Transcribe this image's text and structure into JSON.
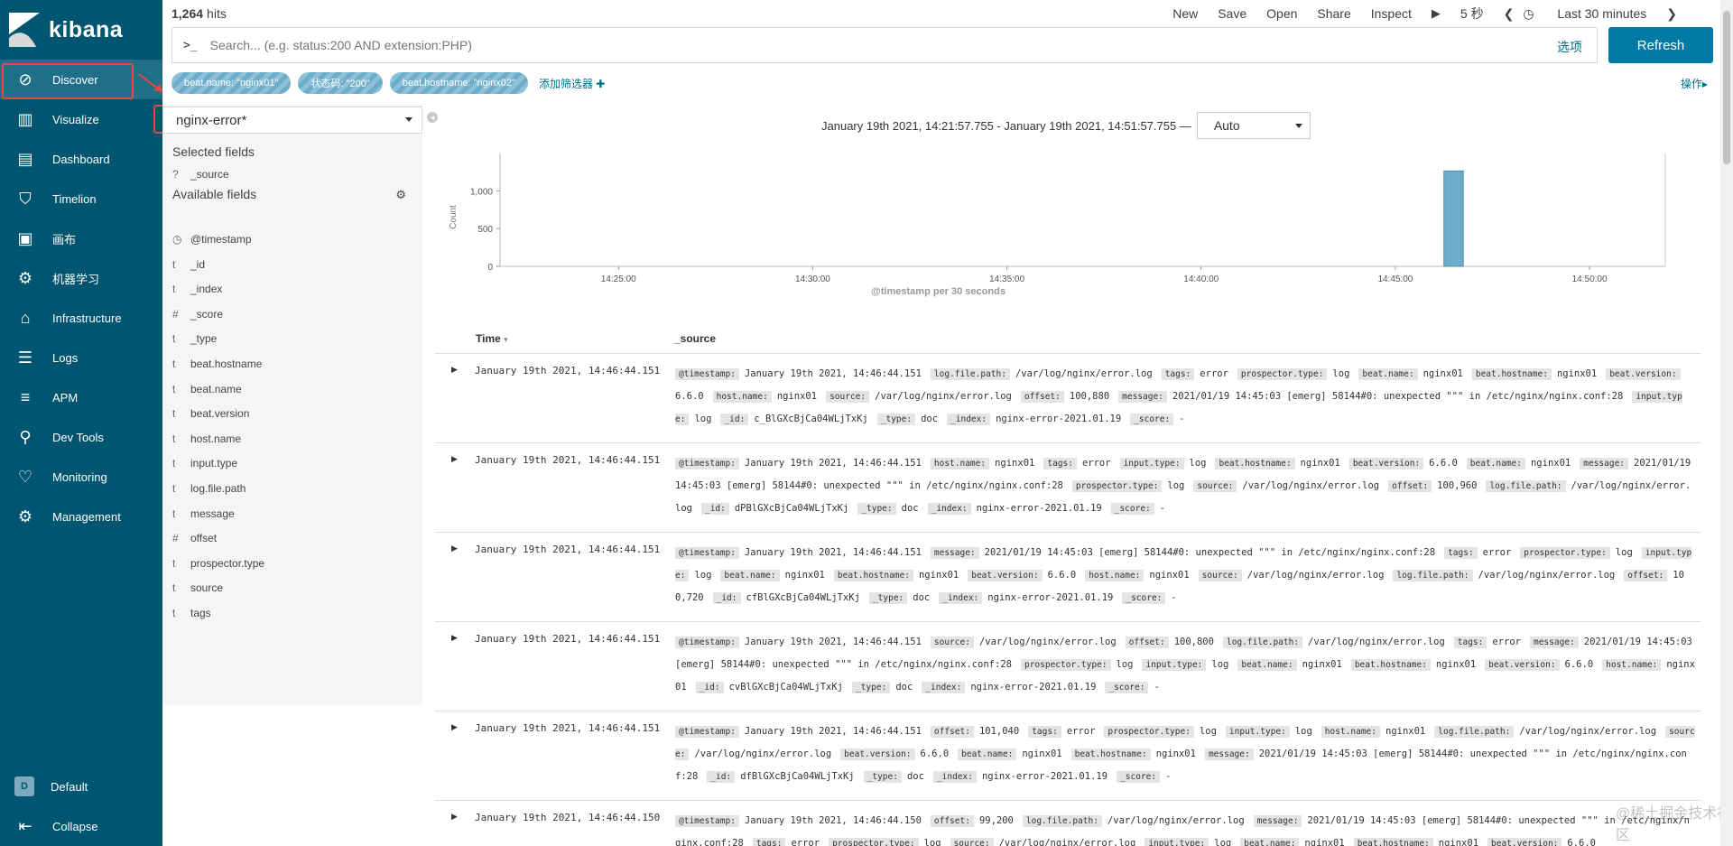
{
  "app": {
    "brand": "kibana"
  },
  "nav": {
    "items": [
      {
        "label": "Discover",
        "icon": "compass-icon"
      },
      {
        "label": "Visualize",
        "icon": "bar-chart-icon"
      },
      {
        "label": "Dashboard",
        "icon": "dashboard-icon"
      },
      {
        "label": "Timelion",
        "icon": "shield-icon"
      },
      {
        "label": "画布",
        "icon": "canvas-icon"
      },
      {
        "label": "机器学习",
        "icon": "machine-learning-icon"
      },
      {
        "label": "Infrastructure",
        "icon": "infrastructure-icon"
      },
      {
        "label": "Logs",
        "icon": "logs-icon"
      },
      {
        "label": "APM",
        "icon": "apm-icon"
      },
      {
        "label": "Dev Tools",
        "icon": "wrench-icon"
      },
      {
        "label": "Monitoring",
        "icon": "heartbeat-icon"
      },
      {
        "label": "Management",
        "icon": "gear-icon"
      }
    ],
    "space_badge": "D",
    "space_label": "Default",
    "collapse_label": "Collapse"
  },
  "topbar": {
    "hits_count": "1,264",
    "hits_label": "hits",
    "new": "New",
    "save": "Save",
    "open": "Open",
    "share": "Share",
    "inspect": "Inspect",
    "play_icon": "▶",
    "interval": "5 秒",
    "prev_icon": "❮",
    "time_range": "Last 30 minutes",
    "next_icon": "❯"
  },
  "search": {
    "prompt": ">_",
    "placeholder": "Search... (e.g. status:200 AND extension:PHP)",
    "options": "选项",
    "refresh": "Refresh"
  },
  "filters": {
    "pills": [
      "beat.name: \"nginx01\"",
      "状态码: \"200\"",
      "beat.hostname: \"nginx02\""
    ],
    "add_filter": "添加筛选器 ✚",
    "actions": "操作▸"
  },
  "fields_panel": {
    "index_pattern": "nginx-error*",
    "selected_heading": "Selected fields",
    "selected": [
      {
        "type": "?",
        "name": "_source"
      }
    ],
    "available_heading": "Available fields",
    "available": [
      {
        "type": "◷",
        "name": "@timestamp"
      },
      {
        "type": "t",
        "name": "_id"
      },
      {
        "type": "t",
        "name": "_index"
      },
      {
        "type": "#",
        "name": "_score"
      },
      {
        "type": "t",
        "name": "_type"
      },
      {
        "type": "t",
        "name": "beat.hostname"
      },
      {
        "type": "t",
        "name": "beat.name"
      },
      {
        "type": "t",
        "name": "beat.version"
      },
      {
        "type": "t",
        "name": "host.name"
      },
      {
        "type": "t",
        "name": "input.type"
      },
      {
        "type": "t",
        "name": "log.file.path"
      },
      {
        "type": "t",
        "name": "message"
      },
      {
        "type": "#",
        "name": "offset"
      },
      {
        "type": "t",
        "name": "prospector.type"
      },
      {
        "type": "t",
        "name": "source"
      },
      {
        "type": "t",
        "name": "tags"
      }
    ]
  },
  "histogram": {
    "range_text": "January 19th 2021, 14:21:57.755 - January 19th 2021, 14:51:57.755 —",
    "interval": "Auto"
  },
  "chart_data": {
    "type": "bar",
    "xlabel": "@timestamp per 30 seconds",
    "ylabel": "Count",
    "x_ticks": [
      "14:25:00",
      "14:30:00",
      "14:35:00",
      "14:40:00",
      "14:45:00",
      "14:50:00"
    ],
    "y_ticks": [
      "0",
      "500",
      "1,000"
    ],
    "ylim": [
      0,
      1400
    ],
    "x_range": [
      "14:21:57",
      "14:51:57"
    ],
    "bars": [
      {
        "x": "14:46:30",
        "value": 1264
      }
    ],
    "bar_color": "#6eadc9"
  },
  "table": {
    "time_header": "Time",
    "source_header": "_source",
    "rows": [
      {
        "time": "January 19th 2021, 14:46:44.151",
        "fields": [
          [
            "@timestamp:",
            "January 19th 2021, 14:46:44.151"
          ],
          [
            "log.file.path:",
            "/var/log/nginx/error.log"
          ],
          [
            "tags:",
            "error"
          ],
          [
            "prospector.type:",
            "log"
          ],
          [
            "beat.name:",
            "nginx01"
          ],
          [
            "beat.hostname:",
            "nginx01"
          ],
          [
            "beat.version:",
            "6.6.0"
          ],
          [
            "host.name:",
            "nginx01"
          ],
          [
            "source:",
            "/var/log/nginx/error.log"
          ],
          [
            "offset:",
            "100,880"
          ],
          [
            "message:",
            "2021/01/19 14:45:03 [emerg] 58144#0: unexpected \"\"\" in /etc/nginx/nginx.conf:28"
          ],
          [
            "input.type:",
            "log"
          ],
          [
            "_id:",
            "c_BlGXcBjCa04WLjTxKj"
          ],
          [
            "_type:",
            "doc"
          ],
          [
            "_index:",
            "nginx-error-2021.01.19"
          ],
          [
            "_score:",
            "-"
          ]
        ]
      },
      {
        "time": "January 19th 2021, 14:46:44.151",
        "fields": [
          [
            "@timestamp:",
            "January 19th 2021, 14:46:44.151"
          ],
          [
            "host.name:",
            "nginx01"
          ],
          [
            "tags:",
            "error"
          ],
          [
            "input.type:",
            "log"
          ],
          [
            "beat.hostname:",
            "nginx01"
          ],
          [
            "beat.version:",
            "6.6.0"
          ],
          [
            "beat.name:",
            "nginx01"
          ],
          [
            "message:",
            "2021/01/19 14:45:03 [emerg] 58144#0: unexpected \"\"\" in /etc/nginx/nginx.conf:28"
          ],
          [
            "prospector.type:",
            "log"
          ],
          [
            "source:",
            "/var/log/nginx/error.log"
          ],
          [
            "offset:",
            "100,960"
          ],
          [
            "log.file.path:",
            "/var/log/nginx/error.log"
          ],
          [
            "_id:",
            "dPBlGXcBjCa04WLjTxKj"
          ],
          [
            "_type:",
            "doc"
          ],
          [
            "_index:",
            "nginx-error-2021.01.19"
          ],
          [
            "_score:",
            "-"
          ]
        ]
      },
      {
        "time": "January 19th 2021, 14:46:44.151",
        "fields": [
          [
            "@timestamp:",
            "January 19th 2021, 14:46:44.151"
          ],
          [
            "message:",
            "2021/01/19 14:45:03 [emerg] 58144#0: unexpected \"\"\" in /etc/nginx/nginx.conf:28"
          ],
          [
            "tags:",
            "error"
          ],
          [
            "prospector.type:",
            "log"
          ],
          [
            "input.type:",
            "log"
          ],
          [
            "beat.name:",
            "nginx01"
          ],
          [
            "beat.hostname:",
            "nginx01"
          ],
          [
            "beat.version:",
            "6.6.0"
          ],
          [
            "host.name:",
            "nginx01"
          ],
          [
            "source:",
            "/var/log/nginx/error.log"
          ],
          [
            "log.file.path:",
            "/var/log/nginx/error.log"
          ],
          [
            "offset:",
            "100,720"
          ],
          [
            "_id:",
            "cfBlGXcBjCa04WLjTxKj"
          ],
          [
            "_type:",
            "doc"
          ],
          [
            "_index:",
            "nginx-error-2021.01.19"
          ],
          [
            "_score:",
            "-"
          ]
        ]
      },
      {
        "time": "January 19th 2021, 14:46:44.151",
        "fields": [
          [
            "@timestamp:",
            "January 19th 2021, 14:46:44.151"
          ],
          [
            "source:",
            "/var/log/nginx/error.log"
          ],
          [
            "offset:",
            "100,800"
          ],
          [
            "log.file.path:",
            "/var/log/nginx/error.log"
          ],
          [
            "tags:",
            "error"
          ],
          [
            "message:",
            "2021/01/19 14:45:03 [emerg] 58144#0: unexpected \"\"\" in /etc/nginx/nginx.conf:28"
          ],
          [
            "prospector.type:",
            "log"
          ],
          [
            "input.type:",
            "log"
          ],
          [
            "beat.name:",
            "nginx01"
          ],
          [
            "beat.hostname:",
            "nginx01"
          ],
          [
            "beat.version:",
            "6.6.0"
          ],
          [
            "host.name:",
            "nginx01"
          ],
          [
            "_id:",
            "cvBlGXcBjCa04WLjTxKj"
          ],
          [
            "_type:",
            "doc"
          ],
          [
            "_index:",
            "nginx-error-2021.01.19"
          ],
          [
            "_score:",
            "-"
          ]
        ]
      },
      {
        "time": "January 19th 2021, 14:46:44.151",
        "fields": [
          [
            "@timestamp:",
            "January 19th 2021, 14:46:44.151"
          ],
          [
            "offset:",
            "101,040"
          ],
          [
            "tags:",
            "error"
          ],
          [
            "prospector.type:",
            "log"
          ],
          [
            "input.type:",
            "log"
          ],
          [
            "host.name:",
            "nginx01"
          ],
          [
            "log.file.path:",
            "/var/log/nginx/error.log"
          ],
          [
            "source:",
            "/var/log/nginx/error.log"
          ],
          [
            "beat.version:",
            "6.6.0"
          ],
          [
            "beat.name:",
            "nginx01"
          ],
          [
            "beat.hostname:",
            "nginx01"
          ],
          [
            "message:",
            "2021/01/19 14:45:03 [emerg] 58144#0: unexpected \"\"\" in /etc/nginx/nginx.conf:28"
          ],
          [
            "_id:",
            "dfBlGXcBjCa04WLjTxKj"
          ],
          [
            "_type:",
            "doc"
          ],
          [
            "_index:",
            "nginx-error-2021.01.19"
          ],
          [
            "_score:",
            "-"
          ]
        ]
      },
      {
        "time": "January 19th 2021, 14:46:44.150",
        "fields": [
          [
            "@timestamp:",
            "January 19th 2021, 14:46:44.150"
          ],
          [
            "offset:",
            "99,200"
          ],
          [
            "log.file.path:",
            "/var/log/nginx/error.log"
          ],
          [
            "message:",
            "2021/01/19 14:45:03 [emerg] 58144#0: unexpected \"\"\" in /etc/nginx/nginx.conf:28"
          ],
          [
            "tags:",
            "error"
          ],
          [
            "prospector.type:",
            "log"
          ],
          [
            "source:",
            "/var/log/nginx/error.log"
          ],
          [
            "input.type:",
            "log"
          ],
          [
            "beat.name:",
            "nginx01"
          ],
          [
            "beat.hostname:",
            "nginx01"
          ],
          [
            "beat.version:",
            "6.6.0"
          ]
        ]
      }
    ]
  },
  "watermark": "@稀土掘金技术社区"
}
